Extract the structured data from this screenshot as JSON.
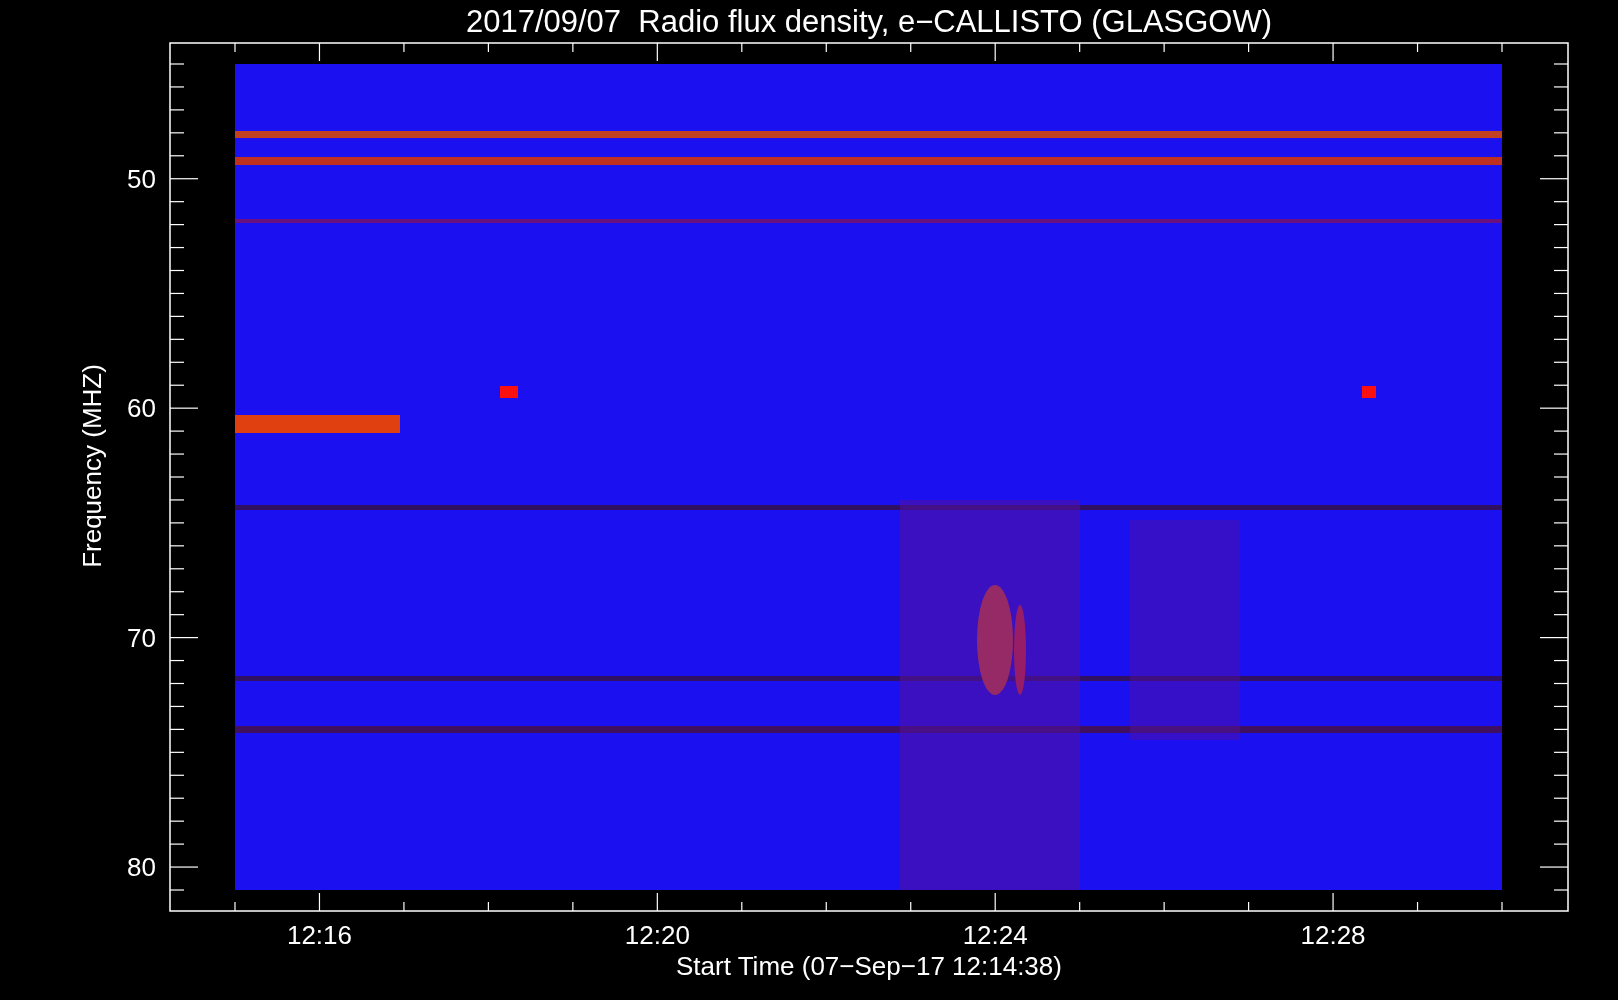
{
  "chart": {
    "title": "2017/09/07  Radio flux density, e−CALLISTO (GLASGOW)",
    "xlabel": "Start Time (07−Sep−17 12:14:38)",
    "ylabel": "Frequency (MHZ)",
    "xticks": [
      "12:16",
      "12:20",
      "12:24",
      "12:28"
    ],
    "yticks": [
      "50",
      "60",
      "70",
      "80"
    ]
  }
}
